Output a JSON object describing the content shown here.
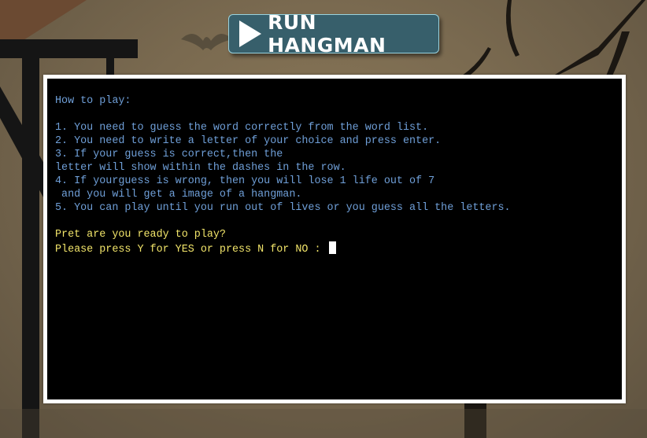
{
  "header": {
    "run_button_label": "RUN HANGMAN",
    "run_button_icon": "play-icon"
  },
  "terminal": {
    "instructions": [
      "How to play:",
      "",
      "1. You need to guess the word correctly from the word list.",
      "2. You need to write a letter of your choice and press enter.",
      "3. If your guess is correct,then the",
      "letter will show within the dashes in the row.",
      "4. If yourguess is wrong, then you will lose 1 life out of 7",
      " and you will get a image of a hangman.",
      "5. You can play until you run out of lives or you guess all the letters.",
      ""
    ],
    "prompt_question": "Pret are you ready to play?",
    "prompt_input": "Please press Y for YES or press N for NO : "
  },
  "colors": {
    "button_bg": "#375f6b",
    "terminal_bg": "#000000",
    "instruction_text": "#6f9fd8",
    "prompt_text": "#f2e56a"
  }
}
